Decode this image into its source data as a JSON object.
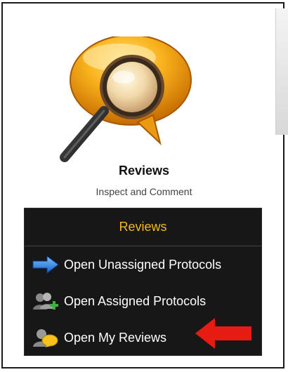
{
  "tile": {
    "title": "Reviews",
    "subtitle": "Inspect and Comment",
    "icon": "magnifier-speech-bubble-icon"
  },
  "menu": {
    "header": "Reviews",
    "items": [
      {
        "label": "Open Unassigned Protocols",
        "icon": "blue-arrow-icon"
      },
      {
        "label": "Open Assigned Protocols",
        "icon": "users-add-icon"
      },
      {
        "label": "Open My Reviews",
        "icon": "user-review-icon"
      }
    ]
  },
  "annotation": {
    "icon": "red-arrow-pointer-icon"
  },
  "colors": {
    "menu_background": "#171717",
    "menu_header_text": "#f5b921",
    "menu_item_text": "#ffffff",
    "accent_orange": "#f7a51b",
    "arrow_red": "#e61c12"
  }
}
